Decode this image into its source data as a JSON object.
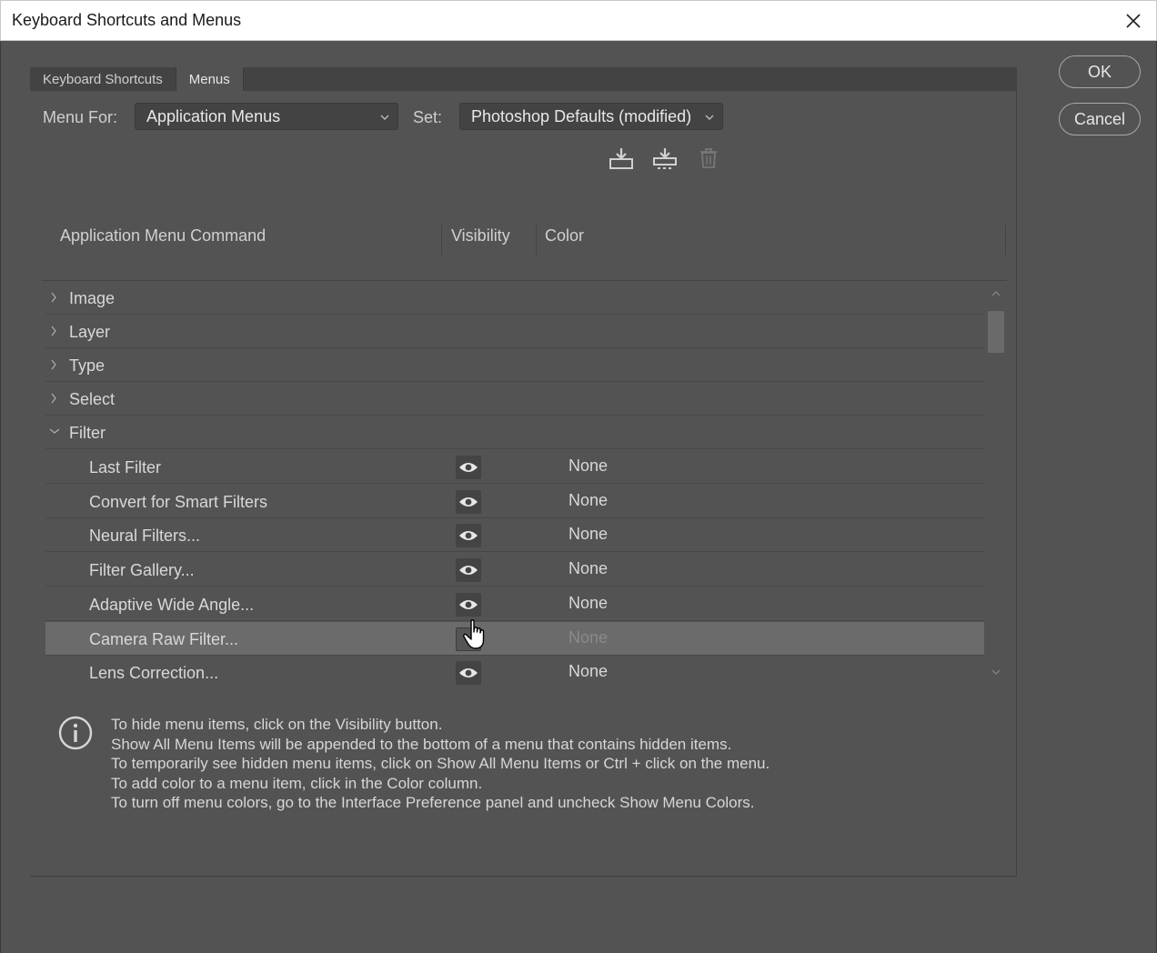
{
  "window": {
    "title": "Keyboard Shortcuts and Menus"
  },
  "tabs": [
    {
      "label": "Keyboard Shortcuts",
      "active": false
    },
    {
      "label": "Menus",
      "active": true
    }
  ],
  "menu_for": {
    "label": "Menu For:",
    "value": "Application Menus"
  },
  "set": {
    "label": "Set:",
    "value": "Photoshop Defaults (modified)"
  },
  "toolbar_icons": [
    "save-set-icon",
    "save-as-set-icon",
    "delete-set-icon"
  ],
  "columns": {
    "command": "Application Menu Command",
    "visibility": "Visibility",
    "color": "Color"
  },
  "rows": [
    {
      "label": "Image",
      "type": "group",
      "expanded": false
    },
    {
      "label": "Layer",
      "type": "group",
      "expanded": false
    },
    {
      "label": "Type",
      "type": "group",
      "expanded": false
    },
    {
      "label": "Select",
      "type": "group",
      "expanded": false
    },
    {
      "label": "Filter",
      "type": "group",
      "expanded": true
    },
    {
      "label": "Last Filter",
      "type": "item",
      "visible": true,
      "color": "None"
    },
    {
      "label": "Convert for Smart Filters",
      "type": "item",
      "visible": true,
      "color": "None"
    },
    {
      "label": "Neural Filters...",
      "type": "item",
      "visible": true,
      "color": "None"
    },
    {
      "label": "Filter Gallery...",
      "type": "item",
      "visible": true,
      "color": "None"
    },
    {
      "label": "Adaptive Wide Angle...",
      "type": "item",
      "visible": true,
      "color": "None"
    },
    {
      "label": "Camera Raw Filter...",
      "type": "item",
      "visible": false,
      "color": "None",
      "selected": true
    },
    {
      "label": "Lens Correction...",
      "type": "item",
      "visible": true,
      "color": "None"
    }
  ],
  "info": {
    "lines": [
      "To hide menu items, click on the Visibility button.",
      "Show All Menu Items will be appended to the bottom of a menu that contains hidden items.",
      "To temporarily see hidden menu items, click on Show All Menu Items or Ctrl + click on the menu.",
      "To add color to a menu item, click in the Color column.",
      "To turn off menu colors, go to the Interface Preference panel and uncheck Show Menu Colors."
    ]
  },
  "buttons": {
    "ok": "OK",
    "cancel": "Cancel"
  },
  "colors": {
    "background": "#535353",
    "selected_row": "#6b6b6b",
    "titlebar": "#ffffff"
  }
}
